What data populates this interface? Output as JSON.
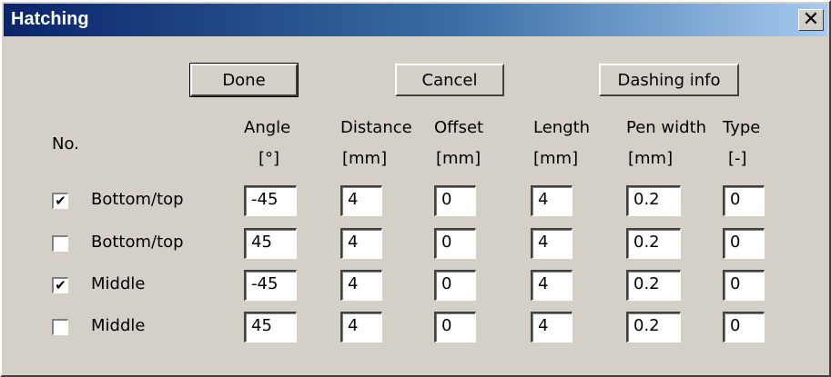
{
  "window": {
    "title": "Hatching",
    "close_glyph": "✕"
  },
  "buttons": {
    "done": "Done",
    "cancel": "Cancel",
    "dashing_info": "Dashing info"
  },
  "columns": {
    "no": "No.",
    "angle": {
      "label": "Angle",
      "unit": "[°]"
    },
    "distance": {
      "label": "Distance",
      "unit": "[mm]"
    },
    "offset": {
      "label": "Offset",
      "unit": "[mm]"
    },
    "length": {
      "label": "Length",
      "unit": "[mm]"
    },
    "pen_width": {
      "label": "Pen width",
      "unit": "[mm]"
    },
    "type": {
      "label": "Type",
      "unit": "[-]"
    }
  },
  "rows": [
    {
      "checked": true,
      "check_glyph": "✔",
      "label": "Bottom/top",
      "angle": "-45",
      "distance": "4",
      "offset": "0",
      "length": "4",
      "pen_width": "0.2",
      "type": "0"
    },
    {
      "checked": false,
      "check_glyph": "",
      "label": "Bottom/top",
      "angle": "45",
      "distance": "4",
      "offset": "0",
      "length": "4",
      "pen_width": "0.2",
      "type": "0"
    },
    {
      "checked": true,
      "check_glyph": "✔",
      "label": "Middle",
      "angle": "-45",
      "distance": "4",
      "offset": "0",
      "length": "4",
      "pen_width": "0.2",
      "type": "0"
    },
    {
      "checked": false,
      "check_glyph": "",
      "label": "Middle",
      "angle": "45",
      "distance": "4",
      "offset": "0",
      "length": "4",
      "pen_width": "0.2",
      "type": "0"
    }
  ]
}
